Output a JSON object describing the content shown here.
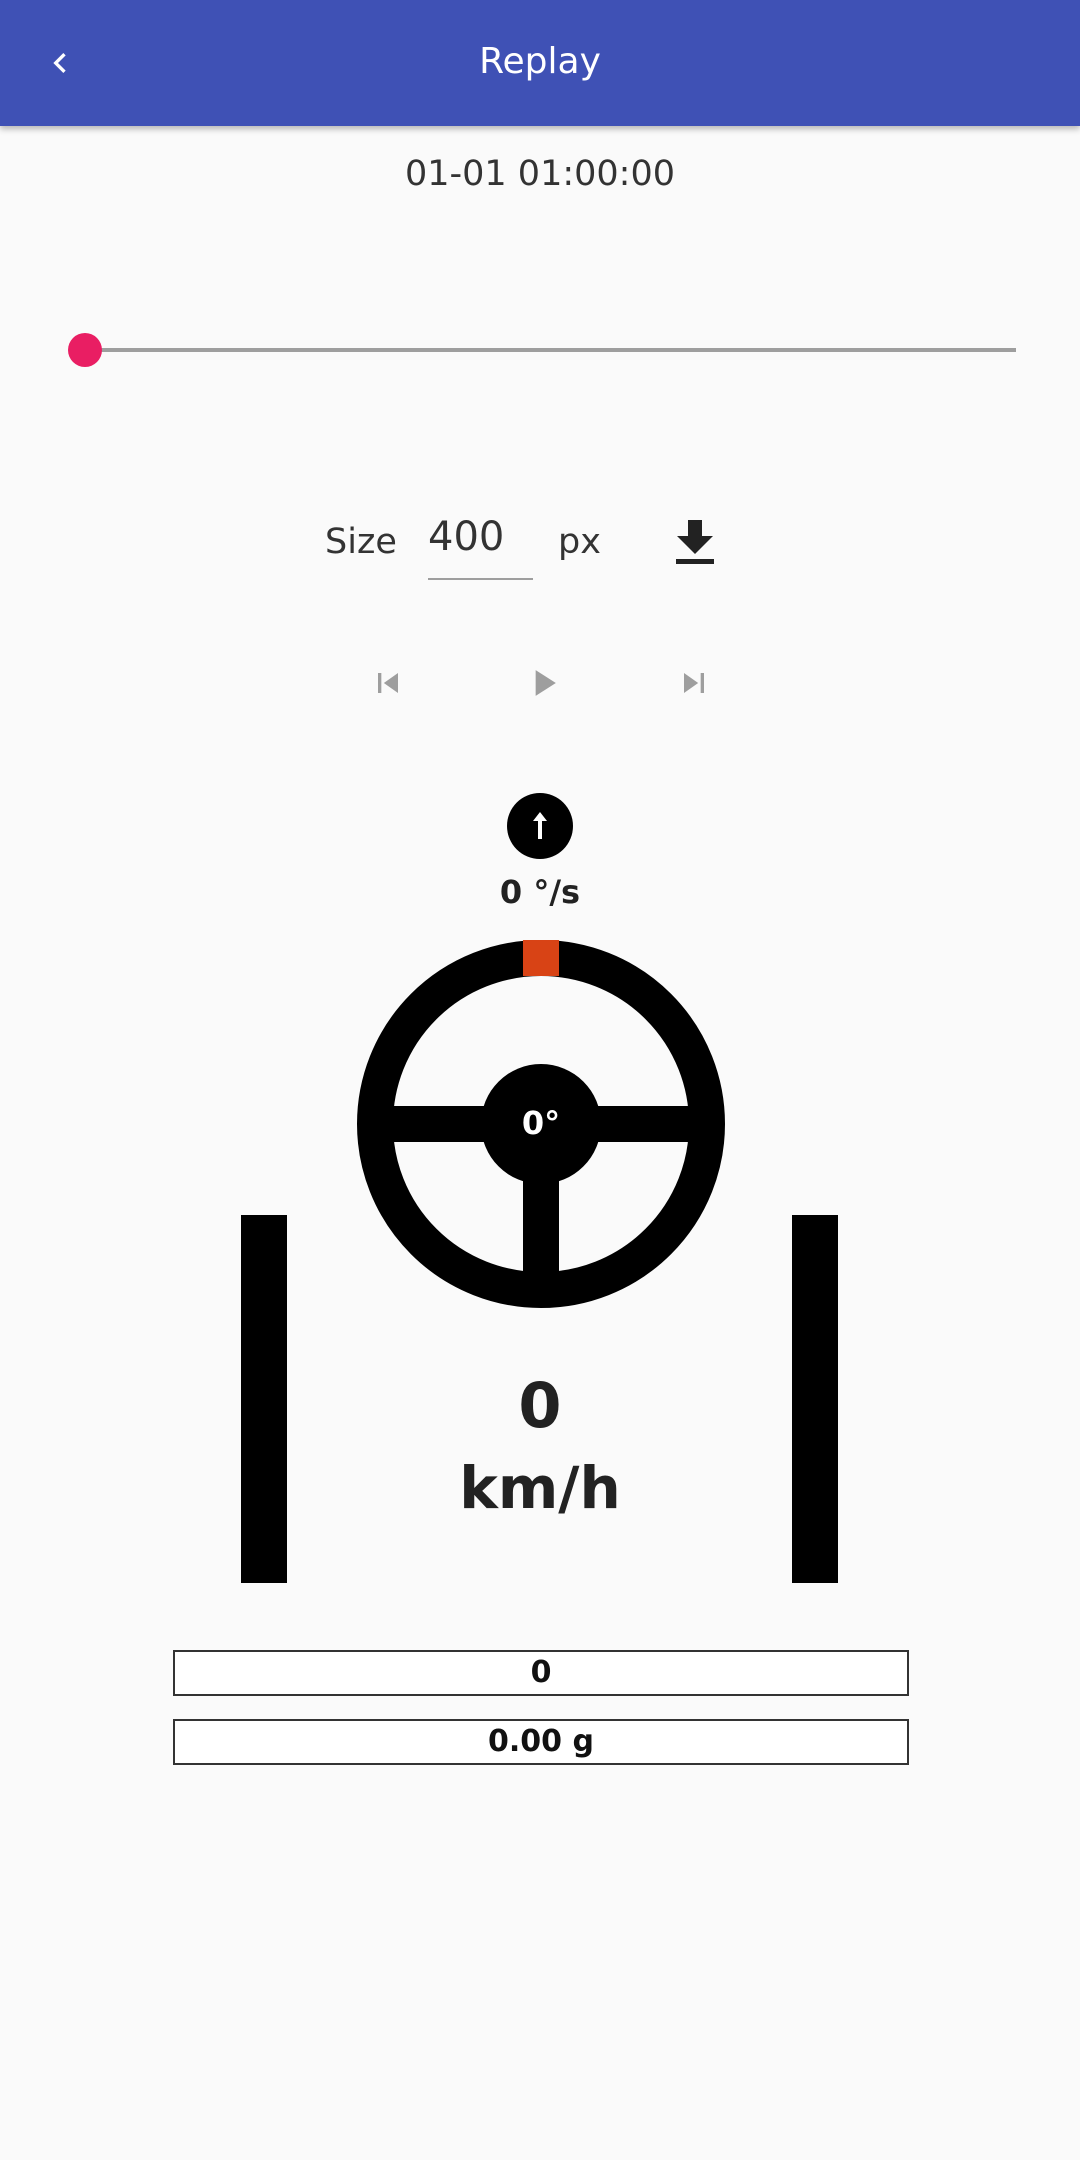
{
  "appbar": {
    "title": "Replay",
    "back_icon": "chevron-left-icon",
    "color": "#3f51b5"
  },
  "timestamp": "01-01 01:00:00",
  "slider": {
    "value": 0,
    "accent_color": "#e91e63"
  },
  "size": {
    "label": "Size",
    "value": "400",
    "unit": "px",
    "download_icon": "download-icon"
  },
  "playback": {
    "skip_previous_icon": "skip-previous-icon",
    "play_icon": "play-icon",
    "skip_next_icon": "skip-next-icon"
  },
  "gauge": {
    "rotation_icon": "arrow-up-icon",
    "rotation_rate": "0 °/s",
    "steering_angle": "0°",
    "marker_color": "#d84315",
    "speed_value": "0",
    "speed_unit": "km/h",
    "info_value_1": "0",
    "info_value_2": "0.00 g"
  }
}
